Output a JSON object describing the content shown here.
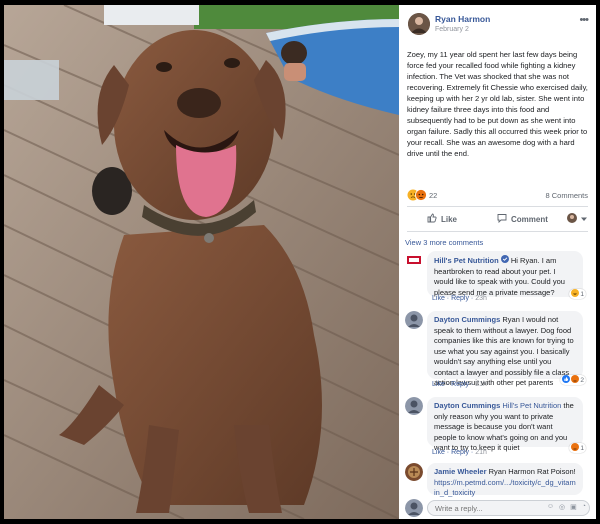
{
  "post": {
    "author": "Ryan Harmon",
    "date": "February 2",
    "text": "Zoey, my 11 year old spent her last few days being force fed your recalled food while fighting a kidney infection. The Vet was shocked that she was not recovering. Extremely fit Chessie who exercised daily, keeping up with her 2 yr old lab, sister. She went into kidney failure three days into this food and subsequently had to be put down as she went into organ failure. Sadly this all occurred this week prior to your recall. She was an awesome dog with a hard drive until the end.",
    "reaction_count": "22",
    "comment_count": "8 Comments",
    "more_icon": "more-horizontal-icon"
  },
  "actions": {
    "like": "Like",
    "comment": "Comment"
  },
  "comments_section": {
    "view_more": "View 3 more comments",
    "reply_placeholder": "Write a reply..."
  },
  "comments": [
    {
      "author": "Hill's Pet Nutrition",
      "verified": true,
      "text": "Hi Ryan. I am heartbroken to read about your pet. I would like to speak with you. Could you please send me a private message?",
      "like": "Like",
      "reply": "Reply",
      "time": "23h",
      "reaction_count": "1"
    },
    {
      "author": "Dayton Cummings",
      "text": "Ryan I would not speak to them without a lawyer. Dog food companies like this are known for trying to use what you say against you. I basically wouldn't say anything else until you contact a lawyer and possibly file a class action lawsuit with other pet parents",
      "like": "Like",
      "reply": "Reply",
      "time": "21h",
      "reaction_count": "2"
    },
    {
      "author": "Dayton Cummings",
      "mention": "Hill's Pet Nutrition",
      "text": "the only reason why you want to private message is because you don't want people to know what's going on and you want to try to keep it quiet",
      "like": "Like",
      "reply": "Reply",
      "time": "21h",
      "reaction_count": "1"
    },
    {
      "author": "Jamie Wheeler",
      "text": "Ryan Harmon Rat Poison!",
      "link": "https://m.petmd.com/.../toxicity/c_dg_vitamin_d_toxicity"
    }
  ],
  "colors": {
    "link_blue": "#385898",
    "meta_grey": "#90949c",
    "bubble_bg": "#f2f3f5",
    "like_blue": "#2078f4",
    "haha_yellow": "#f7b125",
    "angry_red": "#e9710f"
  }
}
